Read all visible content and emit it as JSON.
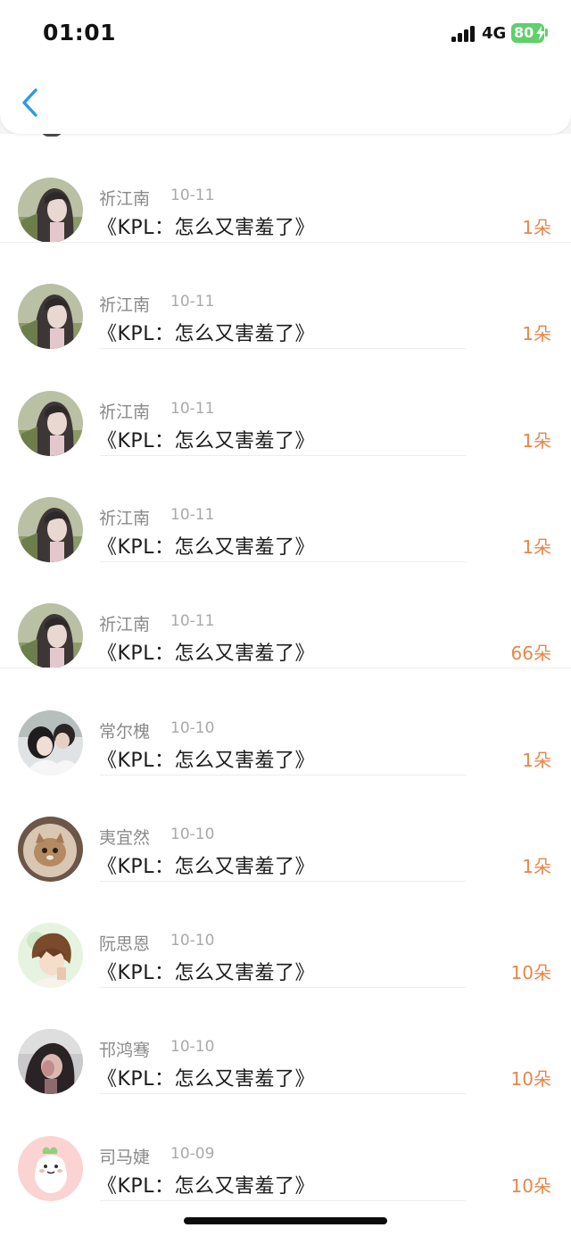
{
  "status_bar": {
    "time": "01:01",
    "network": "4G",
    "battery": "80"
  },
  "nav": {
    "back_icon": "chevron-left-icon"
  },
  "colors": {
    "accent": "#2a9be8",
    "count": "#e8864a",
    "battery": "#5fd06a"
  },
  "items": [
    {
      "name": "祈江南",
      "date": "10-11",
      "title": "《KPL：怎么又害羞了》",
      "count": "1朵",
      "avatar": "anime-girl-avatar"
    },
    {
      "name": "祈江南",
      "date": "10-11",
      "title": "《KPL：怎么又害羞了》",
      "count": "1朵",
      "avatar": "anime-girl-avatar"
    },
    {
      "name": "祈江南",
      "date": "10-11",
      "title": "《KPL：怎么又害羞了》",
      "count": "1朵",
      "avatar": "anime-girl-avatar"
    },
    {
      "name": "祈江南",
      "date": "10-11",
      "title": "《KPL：怎么又害羞了》",
      "count": "1朵",
      "avatar": "anime-girl-avatar"
    },
    {
      "name": "祈江南",
      "date": "10-11",
      "title": "《KPL：怎么又害羞了》",
      "count": "66朵",
      "avatar": "anime-girl-avatar"
    },
    {
      "name": "常尔槐",
      "date": "10-10",
      "title": "《KPL：怎么又害羞了》",
      "count": "1朵",
      "avatar": "couple-photo-avatar"
    },
    {
      "name": "夷宜然",
      "date": "10-10",
      "title": "《KPL：怎么又害羞了》",
      "count": "1朵",
      "avatar": "cat-avatar"
    },
    {
      "name": "阮思恩",
      "date": "10-10",
      "title": "《KPL：怎么又害羞了》",
      "count": "10朵",
      "avatar": "anime-boy-avatar"
    },
    {
      "name": "邗鸿骞",
      "date": "10-10",
      "title": "《KPL：怎么又害羞了》",
      "count": "10朵",
      "avatar": "girl-photo-avatar"
    },
    {
      "name": "司马婕",
      "date": "10-09",
      "title": "《KPL：怎么又害羞了》",
      "count": "10朵",
      "avatar": "cartoon-sprout-avatar"
    }
  ]
}
